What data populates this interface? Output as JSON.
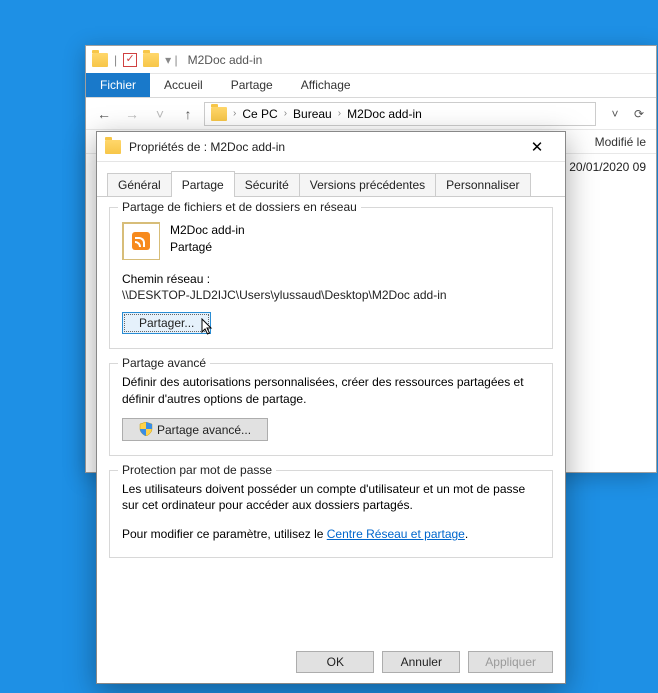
{
  "explorer": {
    "title_name": "M2Doc add-in",
    "tabs": {
      "file": "Fichier",
      "home": "Accueil",
      "share": "Partage",
      "view": "Affichage"
    },
    "breadcrumb": {
      "pc": "Ce PC",
      "desktop": "Bureau",
      "folder": "M2Doc add-in"
    },
    "col_modified": "Modifié le",
    "row_date": "20/01/2020 09"
  },
  "props": {
    "title": "Propriétés de : M2Doc add-in",
    "tabs": {
      "general": "Général",
      "partage": "Partage",
      "securite": "Sécurité",
      "versions": "Versions précédentes",
      "personnaliser": "Personnaliser"
    },
    "g1": {
      "legend": "Partage de fichiers et de dossiers en réseau",
      "name": "M2Doc add-in",
      "status": "Partagé",
      "chemin_label": "Chemin réseau :",
      "chemin_value": "\\\\DESKTOP-JLD2IJC\\Users\\ylussaud\\Desktop\\M2Doc add-in",
      "partager_btn": "Partager..."
    },
    "g2": {
      "legend": "Partage avancé",
      "desc": "Définir des autorisations personnalisées, créer des ressources partagées et définir d'autres options de partage.",
      "btn": "Partage avancé..."
    },
    "g3": {
      "legend": "Protection par mot de passe",
      "line1": "Les utilisateurs doivent posséder un compte d'utilisateur et un mot de passe sur cet ordinateur pour accéder aux dossiers partagés.",
      "line2a": "Pour modifier ce paramètre, utilisez le ",
      "link": "Centre Réseau et partage",
      "line2b": "."
    },
    "buttons": {
      "ok": "OK",
      "cancel": "Annuler",
      "apply": "Appliquer"
    }
  }
}
